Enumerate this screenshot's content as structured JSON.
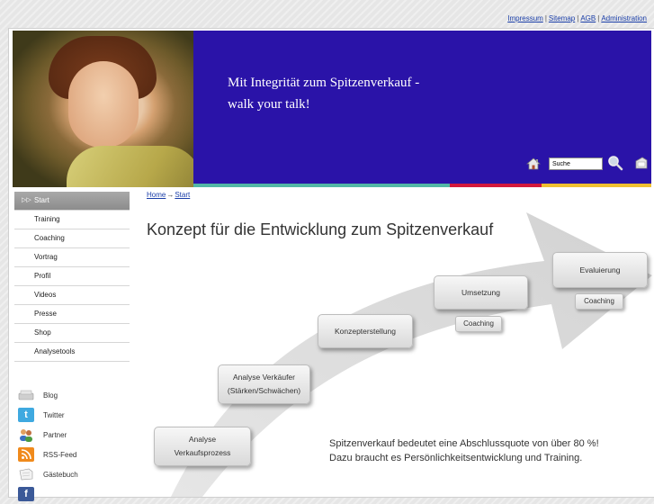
{
  "top_links": [
    "Impressum",
    "Sitemap",
    "AGB",
    "Administration"
  ],
  "banner": {
    "slogan_line1": "Mit Integrität zum Spitzenverkauf -",
    "slogan_line2": "walk your talk!"
  },
  "search": {
    "value": "Suche"
  },
  "nav": {
    "items": [
      "Start",
      "Training",
      "Coaching",
      "Vortrag",
      "Profil",
      "Videos",
      "Presse",
      "Shop",
      "Analysetools"
    ],
    "active": "Start"
  },
  "social": [
    "Blog",
    "Twitter",
    "Partner",
    "RSS-Feed",
    "Gästebuch"
  ],
  "breadcrumb": {
    "home": "Home",
    "arrow": "→",
    "current": "Start"
  },
  "headline": "Konzept für die Entwicklung zum Spitzenverkauf",
  "diagram": {
    "step1_line1": "Analyse",
    "step1_line2": "Verkaufsprozess",
    "step2_line1": "Analyse Verkäufer",
    "step2_line2": "(Stärken/Schwächen)",
    "step3": "Konzepterstellung",
    "step4": "Umsetzung",
    "step4_sub": "Coaching",
    "step5": "Evaluierung",
    "step5_sub": "Coaching"
  },
  "claim": {
    "line1": "Spitzenverkauf bedeutet eine Abschlussquote von über 80 %!",
    "line2": "Dazu braucht es Persönlichkeitsentwicklung und Training."
  },
  "colors": {
    "banner": "#2a13a8",
    "stripe_teal": "#52b7a6",
    "stripe_red": "#d4183c",
    "stripe_yellow": "#f0c030",
    "link": "#1a3ea8"
  }
}
